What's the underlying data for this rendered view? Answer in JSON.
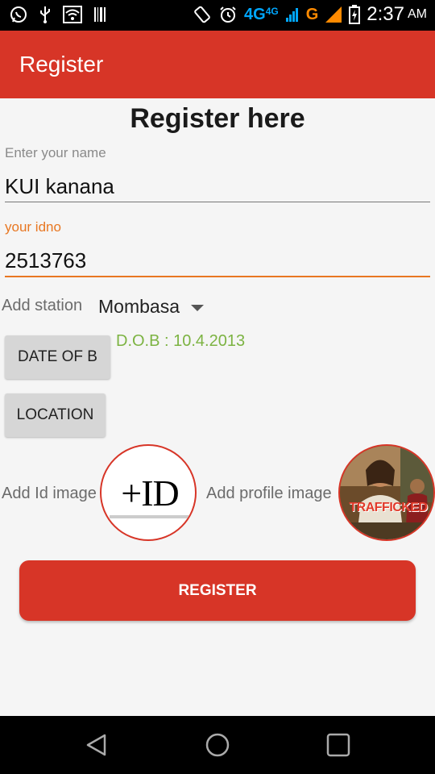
{
  "status_bar": {
    "network_4g": "4G",
    "network_4g_small": "4G",
    "network_g": "G",
    "time": "2:37",
    "ampm": "AM"
  },
  "app_bar": {
    "title": "Register"
  },
  "form": {
    "heading": "Register here",
    "name_label": "Enter your name",
    "name_value": "KUI kanana",
    "idno_label": "your idno",
    "idno_value": "2513763",
    "station_label": "Add station",
    "station_value": "Mombasa",
    "dob_button": "DATE OF B",
    "dob_text": "D.O.B : 10.4.2013",
    "location_button": "LOCATION",
    "id_image_label": "Add Id image",
    "id_image_text": "+ID",
    "profile_image_label": "Add profile image",
    "profile_image_text": "TRAFFICKED",
    "register_button": "REGISTER"
  },
  "colors": {
    "accent": "#d73527",
    "focus_orange": "#e87722",
    "dob_green": "#7cb342"
  }
}
